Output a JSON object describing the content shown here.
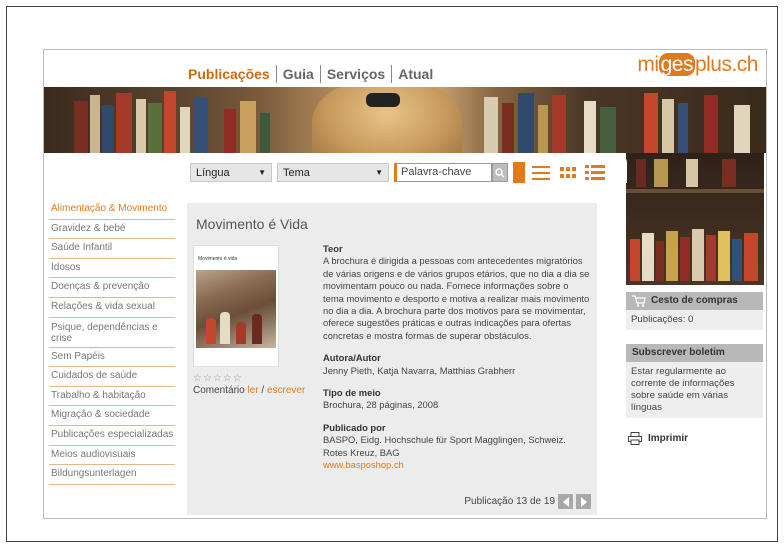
{
  "nav": {
    "items": [
      "Publicações",
      "Guia",
      "Serviços",
      "Atual"
    ],
    "active_index": 0
  },
  "logo": {
    "part1": "mi",
    "part2": "ges",
    "part3": "plus.ch"
  },
  "filters": {
    "language": "Língua",
    "theme": "Tema",
    "keyword_placeholder": "Palavra-chave"
  },
  "sidebar": {
    "items": [
      "Alimentação & Movimento",
      "Gravidez & bebé",
      "Saúde Infantil",
      "Idosos",
      "Doenças & prevenção",
      "Relações & vida sexual",
      "Psique, dependências e crise",
      "Sem Papéis",
      "Cuidados de saúde",
      "Trabalho & habitação",
      "Migração & sociedade",
      "Publicações especializadas",
      "Meios audiovisuais",
      "Bildungsunterlagen"
    ],
    "active_index": 0
  },
  "publication": {
    "title": "Movimento é Vida",
    "cover_title": "Movimento é vida",
    "stars": "☆☆☆☆☆",
    "comment_label": "Comentário",
    "comment_read": "ler",
    "comment_sep": "/",
    "comment_write": "escrever",
    "teor_label": "Teor",
    "teor_text": "A brochura é dirigida a pessoas com antecedentes migratórios de várias origens e de vários grupos etários, que no dia a dia se movimentam pouco ou nada. Fornece informações sobre o tema movimento e desporto e motiva a realizar mais movimento no dia a dia. A brochura parte dos motivos para se movimentar, oferece sugestões práticas e outras indicações para ofertas concretas e mostra formas de superar obstáculos.",
    "author_label": "Autora/Autor",
    "author_text": "Jenny Pieth, Katja Navarra, Matthias Grabherr",
    "media_label": "Tipo de meio",
    "media_text": "Brochura, 28 páginas, 2008",
    "publisher_label": "Publicado por",
    "publisher_text": "BASPO, Eidg. Hochschule für Sport Magglingen, Schweiz. Rotes Kreuz, BAG",
    "publisher_url": "www.basposhop.ch",
    "pager_text": "Publicação 13 de 19"
  },
  "cart": {
    "title": "Cesto de compras",
    "body": "Publicações: 0"
  },
  "newsletter": {
    "title": "Subscrever boletim",
    "body": "Estar regularmente ao corrente de informações sobre saúde em várias línguas"
  },
  "print_label": "Imprimir",
  "colors": {
    "accent": "#e07a1c",
    "panel": "#ececec",
    "box_header": "#b8b8b8"
  }
}
